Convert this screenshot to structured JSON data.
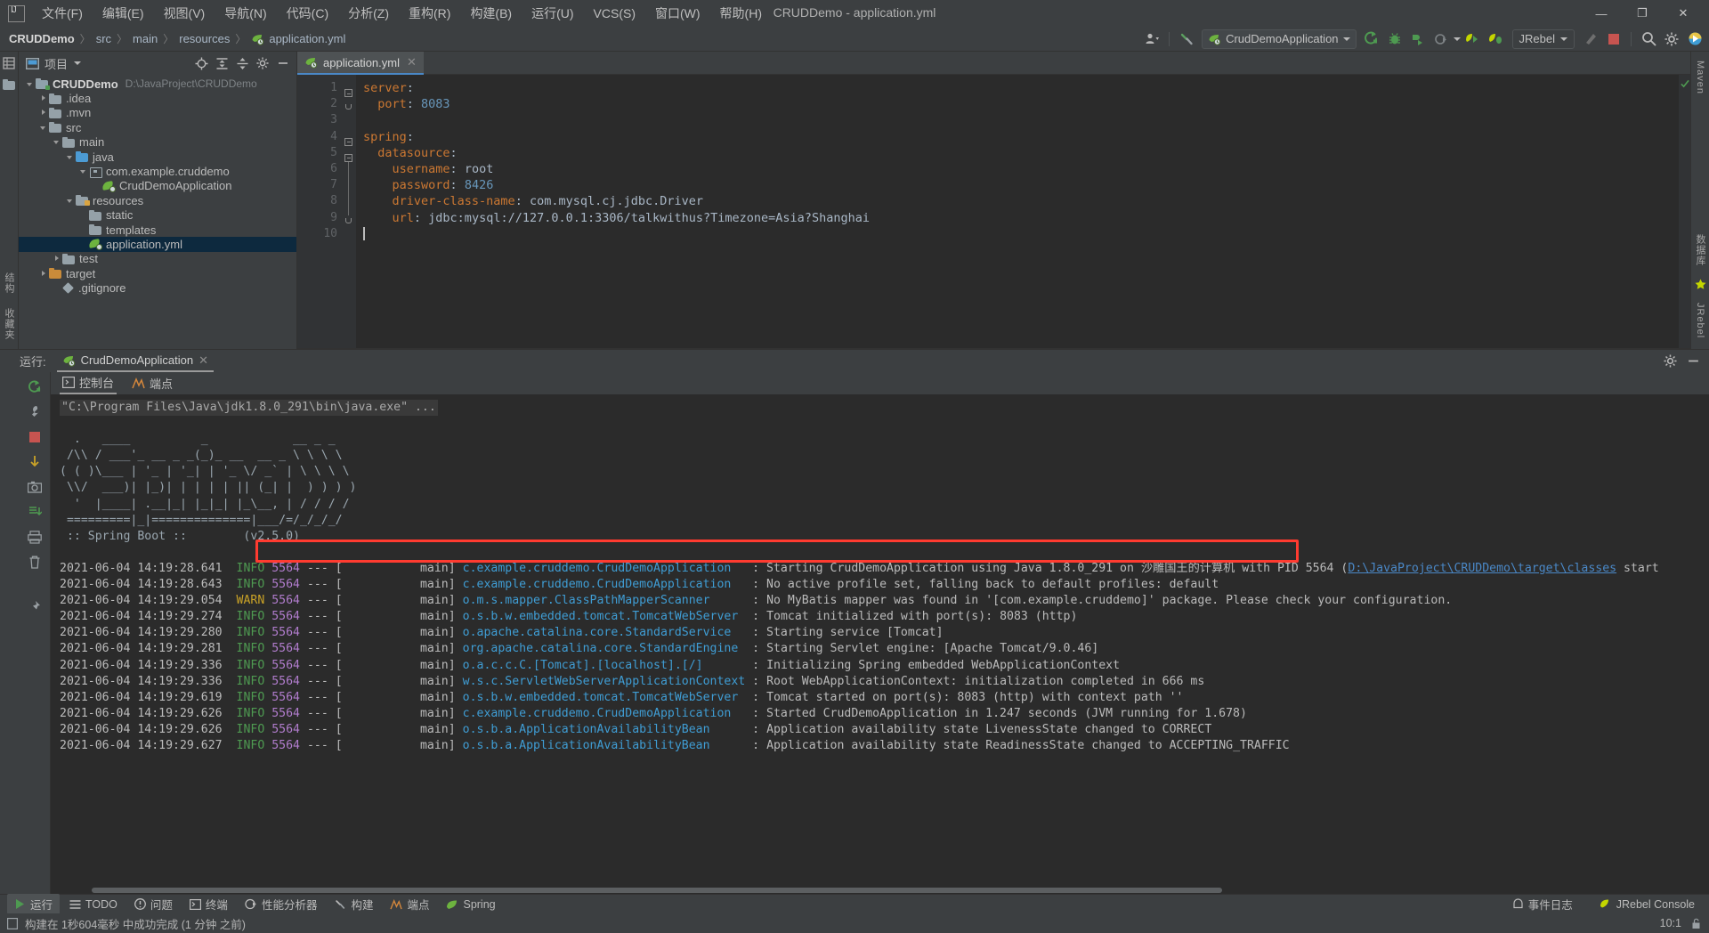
{
  "window": {
    "title": "CRUDDemo - application.yml",
    "minimize": "—",
    "maximize": "❐",
    "close": "✕"
  },
  "menubar": {
    "logo": "IJ",
    "items": [
      {
        "label": "文件(F)",
        "name": "menu-file"
      },
      {
        "label": "编辑(E)",
        "name": "menu-edit"
      },
      {
        "label": "视图(V)",
        "name": "menu-view"
      },
      {
        "label": "导航(N)",
        "name": "menu-navigate"
      },
      {
        "label": "代码(C)",
        "name": "menu-code"
      },
      {
        "label": "分析(Z)",
        "name": "menu-analyze"
      },
      {
        "label": "重构(R)",
        "name": "menu-refactor"
      },
      {
        "label": "构建(B)",
        "name": "menu-build"
      },
      {
        "label": "运行(U)",
        "name": "menu-run"
      },
      {
        "label": "VCS(S)",
        "name": "menu-vcs"
      },
      {
        "label": "窗口(W)",
        "name": "menu-window"
      },
      {
        "label": "帮助(H)",
        "name": "menu-help"
      }
    ]
  },
  "navbar": {
    "crumbs": [
      "CRUDDemo",
      "src",
      "main",
      "resources",
      "application.yml"
    ],
    "separator": "〉",
    "run_config": "CrudDemoApplication",
    "jrebel_label": "JRebel"
  },
  "project": {
    "title": "项目",
    "tree": [
      {
        "label": "CRUDDemo",
        "path": "D:\\JavaProject\\CRUDDemo",
        "indent": 0,
        "arrow": "down",
        "icon": "module",
        "bold": true,
        "selected": false
      },
      {
        "label": ".idea",
        "path": "",
        "indent": 1,
        "arrow": "right",
        "icon": "folder",
        "bold": false,
        "selected": false
      },
      {
        "label": ".mvn",
        "path": "",
        "indent": 1,
        "arrow": "right",
        "icon": "folder",
        "bold": false,
        "selected": false
      },
      {
        "label": "src",
        "path": "",
        "indent": 1,
        "arrow": "down",
        "icon": "folder",
        "bold": false,
        "selected": false
      },
      {
        "label": "main",
        "path": "",
        "indent": 2,
        "arrow": "down",
        "icon": "folder",
        "bold": false,
        "selected": false
      },
      {
        "label": "java",
        "path": "",
        "indent": 3,
        "arrow": "down",
        "icon": "source",
        "bold": false,
        "selected": false
      },
      {
        "label": "com.example.cruddemo",
        "path": "",
        "indent": 4,
        "arrow": "down",
        "icon": "package",
        "bold": false,
        "selected": false
      },
      {
        "label": "CrudDemoApplication",
        "path": "",
        "indent": 5,
        "arrow": "none",
        "icon": "spring",
        "bold": false,
        "selected": false
      },
      {
        "label": "resources",
        "path": "",
        "indent": 3,
        "arrow": "down",
        "icon": "resources",
        "bold": false,
        "selected": false
      },
      {
        "label": "static",
        "path": "",
        "indent": 4,
        "arrow": "none",
        "icon": "folder",
        "bold": false,
        "selected": false
      },
      {
        "label": "templates",
        "path": "",
        "indent": 4,
        "arrow": "none",
        "icon": "folder",
        "bold": false,
        "selected": false
      },
      {
        "label": "application.yml",
        "path": "",
        "indent": 4,
        "arrow": "none",
        "icon": "spring",
        "bold": false,
        "selected": true
      },
      {
        "label": "test",
        "path": "",
        "indent": 2,
        "arrow": "right",
        "icon": "folder",
        "bold": false,
        "selected": false
      },
      {
        "label": "target",
        "path": "",
        "indent": 1,
        "arrow": "right",
        "icon": "target",
        "bold": false,
        "selected": false
      },
      {
        "label": ".gitignore",
        "path": "",
        "indent": 2,
        "arrow": "none",
        "icon": "git",
        "bold": false,
        "selected": false
      }
    ]
  },
  "leftstrip": {
    "labels": [
      "结构",
      "收藏夹"
    ]
  },
  "rightstrip": {
    "labels": [
      "Maven",
      "数据库",
      "JRebel"
    ]
  },
  "editor": {
    "tab_label": "application.yml",
    "tab_close": "✕",
    "line_numbers": [
      "1",
      "2",
      "3",
      "4",
      "5",
      "6",
      "7",
      "8",
      "9",
      "10"
    ],
    "lines": [
      {
        "n": 1,
        "indent": 0,
        "tokens": [
          {
            "t": "server",
            "c": "key"
          },
          {
            "t": ":",
            "c": "plain"
          }
        ]
      },
      {
        "n": 2,
        "indent": 2,
        "tokens": [
          {
            "t": "port",
            "c": "key"
          },
          {
            "t": ": ",
            "c": "plain"
          },
          {
            "t": "8083",
            "c": "num"
          }
        ]
      },
      {
        "n": 3,
        "indent": 0,
        "tokens": []
      },
      {
        "n": 4,
        "indent": 0,
        "tokens": [
          {
            "t": "spring",
            "c": "key"
          },
          {
            "t": ":",
            "c": "plain"
          }
        ]
      },
      {
        "n": 5,
        "indent": 2,
        "tokens": [
          {
            "t": "datasource",
            "c": "key"
          },
          {
            "t": ":",
            "c": "plain"
          }
        ]
      },
      {
        "n": 6,
        "indent": 4,
        "tokens": [
          {
            "t": "username",
            "c": "key"
          },
          {
            "t": ": ",
            "c": "plain"
          },
          {
            "t": "root",
            "c": "plain"
          }
        ]
      },
      {
        "n": 7,
        "indent": 4,
        "tokens": [
          {
            "t": "password",
            "c": "key"
          },
          {
            "t": ": ",
            "c": "plain"
          },
          {
            "t": "8426",
            "c": "num"
          }
        ]
      },
      {
        "n": 8,
        "indent": 4,
        "tokens": [
          {
            "t": "driver-class-name",
            "c": "key"
          },
          {
            "t": ": ",
            "c": "plain"
          },
          {
            "t": "com.mysql.cj.jdbc.Driver",
            "c": "plain"
          }
        ]
      },
      {
        "n": 9,
        "indent": 4,
        "tokens": [
          {
            "t": "url",
            "c": "key"
          },
          {
            "t": ": ",
            "c": "plain"
          },
          {
            "t": "jdbc:mysql://127.0.0.1:3306/talkwithus?Timezone=Asia?Shanghai",
            "c": "plain"
          }
        ]
      },
      {
        "n": 10,
        "indent": 0,
        "tokens": []
      }
    ]
  },
  "run_window": {
    "header_label": "运行:",
    "tab_label": "CrudDemoApplication",
    "tab_close": "✕",
    "console_tab": "控制台",
    "endpoints_tab": "端点",
    "command_line": "\"C:\\Program Files\\Java\\jdk1.8.0_291\\bin\\java.exe\" ...",
    "banner": [
      "  .   ____          _            __ _ _",
      " /\\\\ / ___'_ __ _ _(_)_ __  __ _ \\ \\ \\ \\",
      "( ( )\\___ | '_ | '_| | '_ \\/ _` | \\ \\ \\ \\",
      " \\\\/  ___)| |_)| | | | | || (_| |  ) ) ) )",
      "  '  |____| .__|_| |_|_| |_\\__, | / / / /",
      " =========|_|==============|___/=/_/_/_/"
    ],
    "banner_version_label": " :: Spring Boot :: ",
    "banner_version": "       (v2.5.0)",
    "logs": [
      {
        "ts": "2021-06-04 14:19:28.641",
        "level": "INFO",
        "pid": "5564",
        "thread": "main",
        "logger": "c.example.cruddemo.CrudDemoApplication",
        "msg": "Starting CrudDemoApplication using Java 1.8.0_291 on 沙雕国王的计算机 with PID 5564 (",
        "link": "D:\\JavaProject\\CRUDDemo\\target\\classes",
        "msg_after": " start",
        "highlight": false
      },
      {
        "ts": "2021-06-04 14:19:28.643",
        "level": "INFO",
        "pid": "5564",
        "thread": "main",
        "logger": "c.example.cruddemo.CrudDemoApplication",
        "msg": "No active profile set, falling back to default profiles: default",
        "link": "",
        "msg_after": "",
        "highlight": false
      },
      {
        "ts": "2021-06-04 14:19:29.054",
        "level": "WARN",
        "pid": "5564",
        "thread": "main",
        "logger": "o.m.s.mapper.ClassPathMapperScanner",
        "msg": "No MyBatis mapper was found in '[com.example.cruddemo]' package. Please check your configuration.",
        "link": "",
        "msg_after": "",
        "highlight": true
      },
      {
        "ts": "2021-06-04 14:19:29.274",
        "level": "INFO",
        "pid": "5564",
        "thread": "main",
        "logger": "o.s.b.w.embedded.tomcat.TomcatWebServer",
        "msg": "Tomcat initialized with port(s): 8083 (http)",
        "link": "",
        "msg_after": "",
        "highlight": false
      },
      {
        "ts": "2021-06-04 14:19:29.280",
        "level": "INFO",
        "pid": "5564",
        "thread": "main",
        "logger": "o.apache.catalina.core.StandardService",
        "msg": "Starting service [Tomcat]",
        "link": "",
        "msg_after": "",
        "highlight": false
      },
      {
        "ts": "2021-06-04 14:19:29.281",
        "level": "INFO",
        "pid": "5564",
        "thread": "main",
        "logger": "org.apache.catalina.core.StandardEngine",
        "msg": "Starting Servlet engine: [Apache Tomcat/9.0.46]",
        "link": "",
        "msg_after": "",
        "highlight": false
      },
      {
        "ts": "2021-06-04 14:19:29.336",
        "level": "INFO",
        "pid": "5564",
        "thread": "main",
        "logger": "o.a.c.c.C.[Tomcat].[localhost].[/]",
        "msg": "Initializing Spring embedded WebApplicationContext",
        "link": "",
        "msg_after": "",
        "highlight": false
      },
      {
        "ts": "2021-06-04 14:19:29.336",
        "level": "INFO",
        "pid": "5564",
        "thread": "main",
        "logger": "w.s.c.ServletWebServerApplicationContext",
        "msg": "Root WebApplicationContext: initialization completed in 666 ms",
        "link": "",
        "msg_after": "",
        "highlight": false
      },
      {
        "ts": "2021-06-04 14:19:29.619",
        "level": "INFO",
        "pid": "5564",
        "thread": "main",
        "logger": "o.s.b.w.embedded.tomcat.TomcatWebServer",
        "msg": "Tomcat started on port(s): 8083 (http) with context path ''",
        "link": "",
        "msg_after": "",
        "highlight": false
      },
      {
        "ts": "2021-06-04 14:19:29.626",
        "level": "INFO",
        "pid": "5564",
        "thread": "main",
        "logger": "c.example.cruddemo.CrudDemoApplication",
        "msg": "Started CrudDemoApplication in 1.247 seconds (JVM running for 1.678)",
        "link": "",
        "msg_after": "",
        "highlight": false
      },
      {
        "ts": "2021-06-04 14:19:29.626",
        "level": "INFO",
        "pid": "5564",
        "thread": "main",
        "logger": "o.s.b.a.ApplicationAvailabilityBean",
        "msg": "Application availability state LivenessState changed to CORRECT",
        "link": "",
        "msg_after": "",
        "highlight": false
      },
      {
        "ts": "2021-06-04 14:19:29.627",
        "level": "INFO",
        "pid": "5564",
        "thread": "main",
        "logger": "o.s.b.a.ApplicationAvailabilityBean",
        "msg": "Application availability state ReadinessState changed to ACCEPTING_TRAFFIC",
        "link": "",
        "msg_after": "",
        "highlight": false
      }
    ]
  },
  "toolwindow_bar": {
    "items": [
      {
        "label": "运行",
        "name": "toolwin-run",
        "icon": "play-icon",
        "active": true
      },
      {
        "label": "TODO",
        "name": "toolwin-todo",
        "icon": "list-icon",
        "active": false
      },
      {
        "label": "问题",
        "name": "toolwin-problems",
        "icon": "warning-icon",
        "active": false
      },
      {
        "label": "终端",
        "name": "toolwin-terminal",
        "icon": "terminal-icon",
        "active": false
      },
      {
        "label": "性能分析器",
        "name": "toolwin-profiler",
        "icon": "profiler-icon",
        "active": false
      },
      {
        "label": "构建",
        "name": "toolwin-build",
        "icon": "hammer-icon",
        "active": false
      },
      {
        "label": "端点",
        "name": "toolwin-endpoints",
        "icon": "endpoints-icon",
        "active": false
      },
      {
        "label": "Spring",
        "name": "toolwin-spring",
        "icon": "spring-leaf-icon",
        "active": false
      }
    ],
    "right_items": [
      {
        "label": "事件日志",
        "name": "event-log",
        "icon": "bell-icon"
      },
      {
        "label": "JRebel Console",
        "name": "jrebel-console",
        "icon": "jrebel-icon"
      }
    ]
  },
  "statusbar": {
    "message": "构建在 1秒604毫秒 中成功完成 (1 分钟 之前)",
    "caret_position": "10:1",
    "lock_icon": "lock-icon"
  },
  "colors": {
    "accent_blue": "#4a88c7",
    "spring_green": "#6db33f",
    "warn_red": "#ff3b30",
    "info_green": "#4e9a51",
    "panel_bg": "#3c3f41",
    "editor_bg": "#2b2b2b"
  }
}
